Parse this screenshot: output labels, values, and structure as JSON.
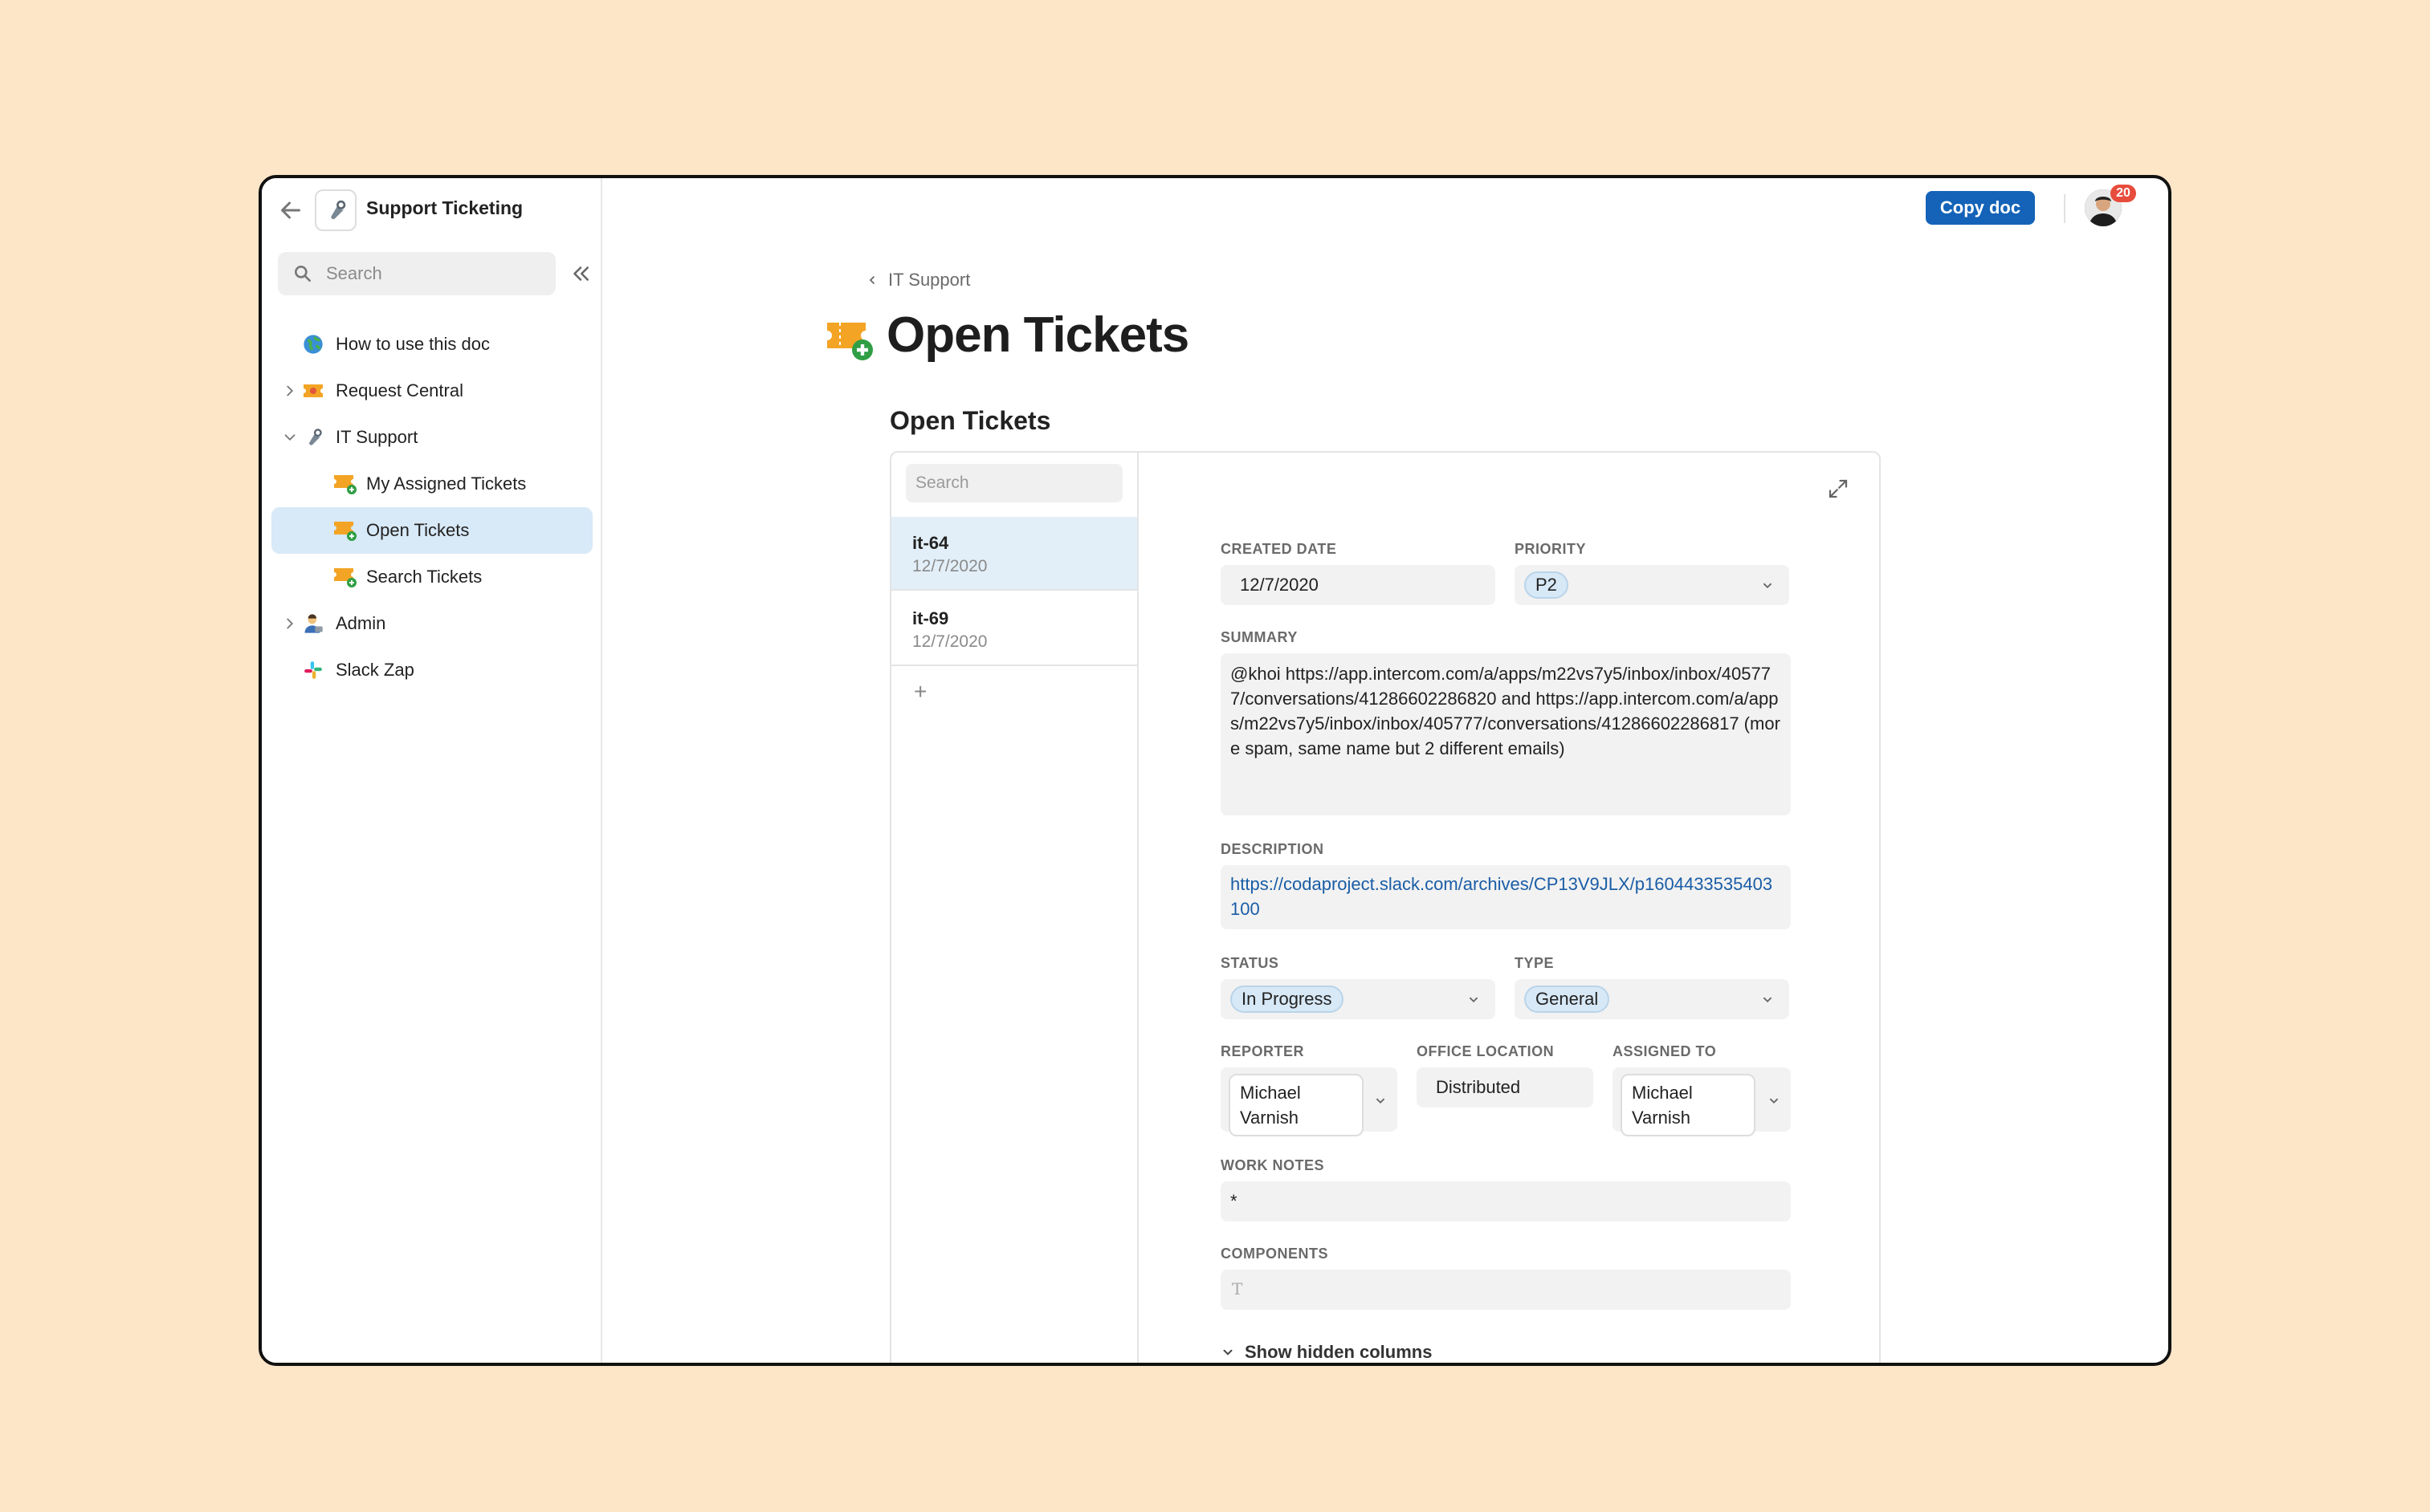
{
  "doc": {
    "title": "Support Ticketing",
    "copy_label": "Copy doc",
    "notification_count": "20"
  },
  "sidebar": {
    "search_placeholder": "Search",
    "items": [
      {
        "label": "How to use this doc",
        "icon": "globe-icon"
      },
      {
        "label": "Request Central",
        "icon": "ticket-icon",
        "chevron": "right"
      },
      {
        "label": "IT Support",
        "icon": "wrench-icon",
        "chevron": "down"
      },
      {
        "label": "My Assigned Tickets",
        "icon": "ticket-add-icon"
      },
      {
        "label": "Open Tickets",
        "icon": "ticket-add-icon",
        "active": true
      },
      {
        "label": "Search Tickets",
        "icon": "ticket-add-icon"
      },
      {
        "label": "Admin",
        "icon": "admin-person-icon",
        "chevron": "right"
      },
      {
        "label": "Slack Zap",
        "icon": "slack-icon"
      }
    ]
  },
  "page": {
    "breadcrumb": "IT Support",
    "title": "Open Tickets",
    "section_title": "Open Tickets"
  },
  "list": {
    "search_placeholder": "Search",
    "rows": [
      {
        "id": "it-64",
        "date": "12/7/2020"
      },
      {
        "id": "it-69",
        "date": "12/7/2020"
      }
    ],
    "add": "+"
  },
  "form": {
    "created_date": {
      "label": "CREATED DATE",
      "value": "12/7/2020"
    },
    "priority": {
      "label": "PRIORITY",
      "value": "P2"
    },
    "summary": {
      "label": "SUMMARY",
      "value": "@khoi https://app.intercom.com/a/apps/m22vs7y5/inbox/inbox/405777/conversations/41286602286820 and https://app.intercom.com/a/apps/m22vs7y5/inbox/inbox/405777/conversations/41286602286817 (more spam, same name but 2 different emails)"
    },
    "description": {
      "label": "DESCRIPTION",
      "value": "https://codaproject.slack.com/archives/CP13V9JLX/p1604433535403100"
    },
    "status": {
      "label": "STATUS",
      "value": "In Progress"
    },
    "type": {
      "label": "TYPE",
      "value": "General"
    },
    "reporter": {
      "label": "REPORTER",
      "value": "Michael Varnish"
    },
    "office_location": {
      "label": "OFFICE LOCATION",
      "value": "Distributed"
    },
    "assigned_to": {
      "label": "ASSIGNED TO",
      "value": "Michael Varnish"
    },
    "work_notes": {
      "label": "WORK NOTES",
      "value": "*"
    },
    "components": {
      "label": "COMPONENTS",
      "placeholder": "T"
    },
    "show_hidden": "Show hidden columns"
  },
  "colors": {
    "accent": "#1463b8",
    "background": "#fde6c8",
    "active_nav": "#d8e9f7",
    "badge": "#e74c3c"
  }
}
